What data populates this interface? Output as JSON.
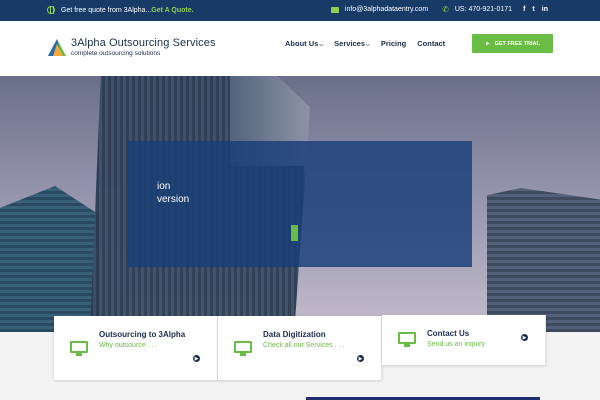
{
  "topbar": {
    "quote_text": "Get free quote from 3Alpha...",
    "quote_link": "Get A Quote.",
    "email": "info@3alphadataentry.com",
    "phone": "US: 470-921-0171",
    "social": [
      "f",
      "t",
      "in"
    ]
  },
  "header": {
    "brand": "3Alpha Outsourcing Services",
    "tagline": "complete outsourcing solutions",
    "nav": [
      {
        "label": "About Us",
        "dropdown": true
      },
      {
        "label": "Services",
        "dropdown": true
      },
      {
        "label": "Pricing",
        "dropdown": false
      },
      {
        "label": "Contact",
        "dropdown": false
      }
    ],
    "cta_label": "GET FREE TRIAL"
  },
  "hero": {
    "line1": "ion",
    "line2": "version"
  },
  "cards": [
    {
      "title": "Outsourcing to 3Alpha",
      "sub": "Why outsource . . .",
      "icon": "monitor-icon"
    },
    {
      "title": "Data Digitization",
      "sub": "Check all our Services . . .",
      "icon": "monitor-icon"
    },
    {
      "title": "Contact Us",
      "sub": "Send us an inquiry",
      "icon": "monitor-icon"
    }
  ],
  "colors": {
    "navy": "#173a67",
    "green": "#69bd45",
    "text": "#1b2d4f"
  }
}
